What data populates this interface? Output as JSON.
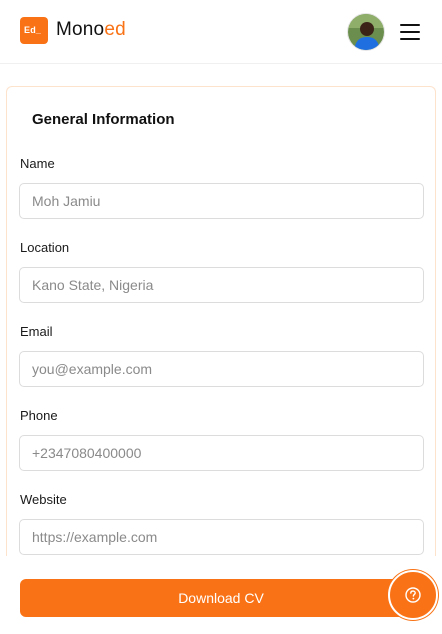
{
  "header": {
    "logo_mark": "Ed_",
    "brand_main": "Mono",
    "brand_accent": "ed",
    "avatar_icon": "user-avatar",
    "menu_icon": "hamburger-menu-icon"
  },
  "form": {
    "title": "General Information",
    "fields": [
      {
        "label": "Name",
        "placeholder": "Moh Jamiu",
        "value": ""
      },
      {
        "label": "Location",
        "placeholder": "Kano State, Nigeria",
        "value": ""
      },
      {
        "label": "Email",
        "placeholder": "you@example.com",
        "value": ""
      },
      {
        "label": "Phone",
        "placeholder": "+2347080400000",
        "value": ""
      },
      {
        "label": "Website",
        "placeholder": "https://example.com",
        "value": ""
      }
    ]
  },
  "footer": {
    "download_label": "Download CV",
    "help_icon": "help-circle-icon"
  },
  "colors": {
    "accent": "#f97316",
    "card_border": "#fde2cc"
  }
}
